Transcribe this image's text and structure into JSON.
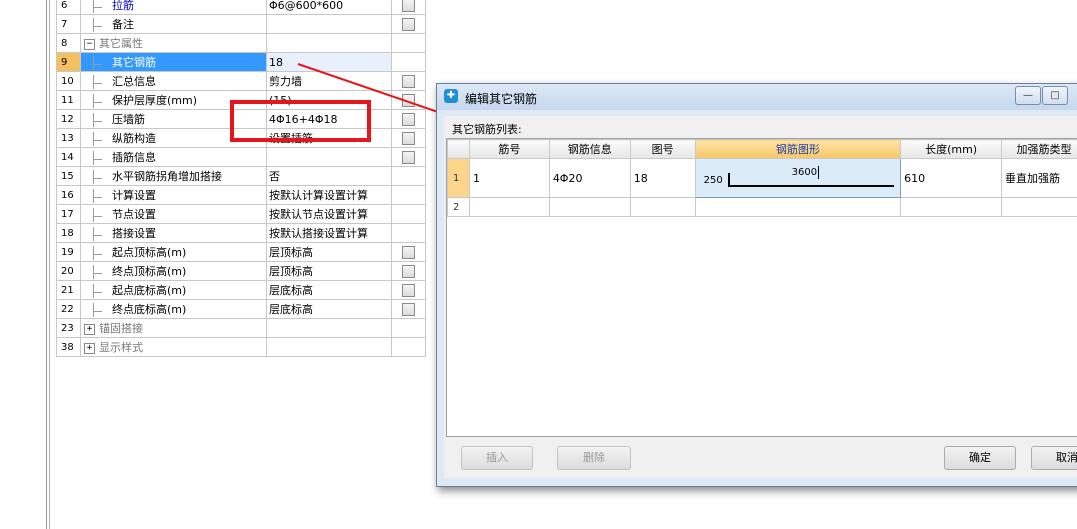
{
  "properties": [
    {
      "num": "6",
      "name": "拉筋",
      "value": "Φ6@600*600",
      "check": true,
      "indent": true,
      "blue": true
    },
    {
      "num": "7",
      "name": "备注",
      "value": "",
      "check": true,
      "indent": true
    },
    {
      "num": "8",
      "name": "其它属性",
      "value": "",
      "check": false,
      "group": "collapse",
      "gray": true
    },
    {
      "num": "9",
      "name": "其它钢筋",
      "value": "18",
      "check": false,
      "indent": true,
      "selected": true
    },
    {
      "num": "10",
      "name": "汇总信息",
      "value": "剪力墙",
      "check": true,
      "indent": true
    },
    {
      "num": "11",
      "name": "保护层厚度(mm)",
      "value": "(15)",
      "check": true,
      "indent": true
    },
    {
      "num": "12",
      "name": "压墙筋",
      "value": "4Φ16+4Φ18",
      "check": true,
      "indent": true
    },
    {
      "num": "13",
      "name": "纵筋构造",
      "value": "设置插筋",
      "check": true,
      "indent": true
    },
    {
      "num": "14",
      "name": "插筋信息",
      "value": "",
      "check": true,
      "indent": true
    },
    {
      "num": "15",
      "name": "水平钢筋拐角增加搭接",
      "value": "否",
      "check": false,
      "indent": true
    },
    {
      "num": "16",
      "name": "计算设置",
      "value": "按默认计算设置计算",
      "check": false,
      "indent": true
    },
    {
      "num": "17",
      "name": "节点设置",
      "value": "按默认节点设置计算",
      "check": false,
      "indent": true
    },
    {
      "num": "18",
      "name": "搭接设置",
      "value": "按默认搭接设置计算",
      "check": false,
      "indent": true
    },
    {
      "num": "19",
      "name": "起点顶标高(m)",
      "value": "层顶标高",
      "check": true,
      "indent": true
    },
    {
      "num": "20",
      "name": "终点顶标高(m)",
      "value": "层顶标高",
      "check": true,
      "indent": true
    },
    {
      "num": "21",
      "name": "起点底标高(m)",
      "value": "层底标高",
      "check": true,
      "indent": true
    },
    {
      "num": "22",
      "name": "终点底标高(m)",
      "value": "层底标高",
      "check": true,
      "indent": true
    },
    {
      "num": "23",
      "name": "锚固搭接",
      "value": "",
      "check": false,
      "group": "expand",
      "gray": true
    },
    {
      "num": "38",
      "name": "显示样式",
      "value": "",
      "check": false,
      "group": "expand",
      "gray": true
    }
  ],
  "dialog": {
    "title": "编辑其它钢筋",
    "list_label": "其它钢筋列表:",
    "columns": [
      "",
      "筋号",
      "钢筋信息",
      "图号",
      "钢筋图形",
      "长度(mm)",
      "加强筋类型"
    ],
    "rows": [
      {
        "rn": "1",
        "id": "1",
        "info": "4Φ20",
        "fig": "18",
        "shape_left": "250",
        "shape_top": "3600",
        "length": "610",
        "type": "垂直加强筋"
      },
      {
        "rn": "2",
        "id": "",
        "info": "",
        "fig": "",
        "shape_left": "",
        "shape_top": "",
        "length": "",
        "type": ""
      }
    ],
    "insert_label": "插入",
    "delete_label": "删除",
    "ok_label": "确定",
    "cancel_label": "取消",
    "minimize_glyph": "—",
    "maximize_glyph": "□"
  },
  "colors": {
    "annotation": "#e8151b",
    "selected_row": "#3399ff",
    "active_header": "#f8c76a"
  }
}
